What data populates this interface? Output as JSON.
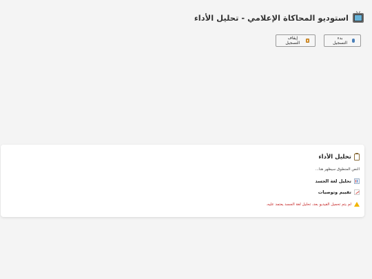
{
  "header": {
    "title": "استوديو المحاكاة الإعلامي - تحليل الأداء",
    "icon": "tv-icon"
  },
  "controls": {
    "record_label": "بدء التسجيل",
    "stop_label": "إيقاف التسجيل"
  },
  "analysis": {
    "title": "تحليل الأداء",
    "transcript_placeholder": "النص المنطوق سيظهر هنا...",
    "body_language_label": "تحليل لغة الجسد",
    "recommendations_label": "تقييم وتوصيات",
    "warning_text": "لم يتم تحميل الفيديو بعد، تحليل لغة الجسد يعتمد عليه."
  },
  "colors": {
    "warning": "#c62828",
    "accent": "#f2b400"
  }
}
